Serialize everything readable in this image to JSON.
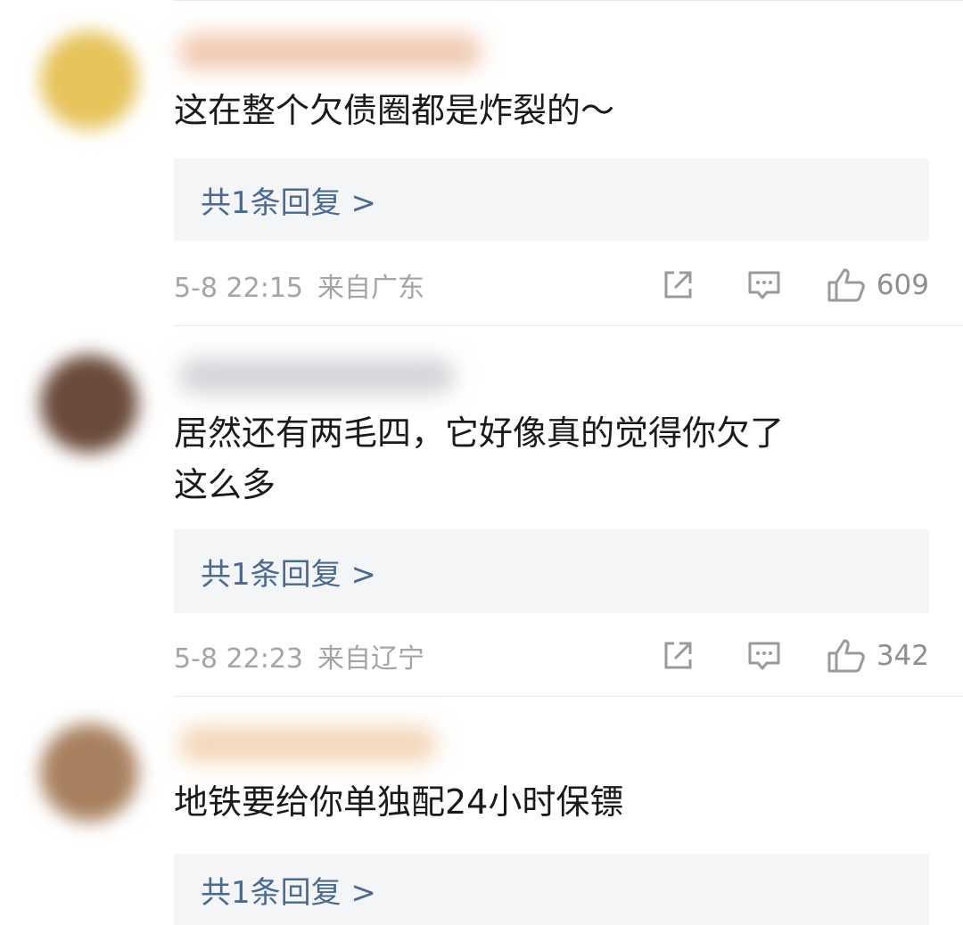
{
  "comments": [
    {
      "text_lines": [
        "这在整个欠债圈都是炸裂的～"
      ],
      "reply_label": "共1条回复 >",
      "time": "5-8 22:15",
      "location": "来自广东",
      "likes": "609",
      "avatar_color": "#e6c45a",
      "name_color": "#f1c9b0"
    },
    {
      "text_lines": [
        "居然还有两毛四，它好像真的觉得你欠了",
        "这么多"
      ],
      "reply_label": "共1条回复 >",
      "time": "5-8 22:23",
      "location": "来自辽宁",
      "likes": "342",
      "avatar_color": "#6a4a3a",
      "name_color": "#d3d5d8"
    },
    {
      "text_lines": [
        "地铁要给你单独配24小时保镖"
      ],
      "reply_label": "共1条回复 >",
      "avatar_color": "#a8805e",
      "name_color": "#f3d7b8"
    }
  ],
  "icons": {
    "share": "share-icon",
    "comment": "comment-icon",
    "like": "thumbs-up-icon"
  }
}
